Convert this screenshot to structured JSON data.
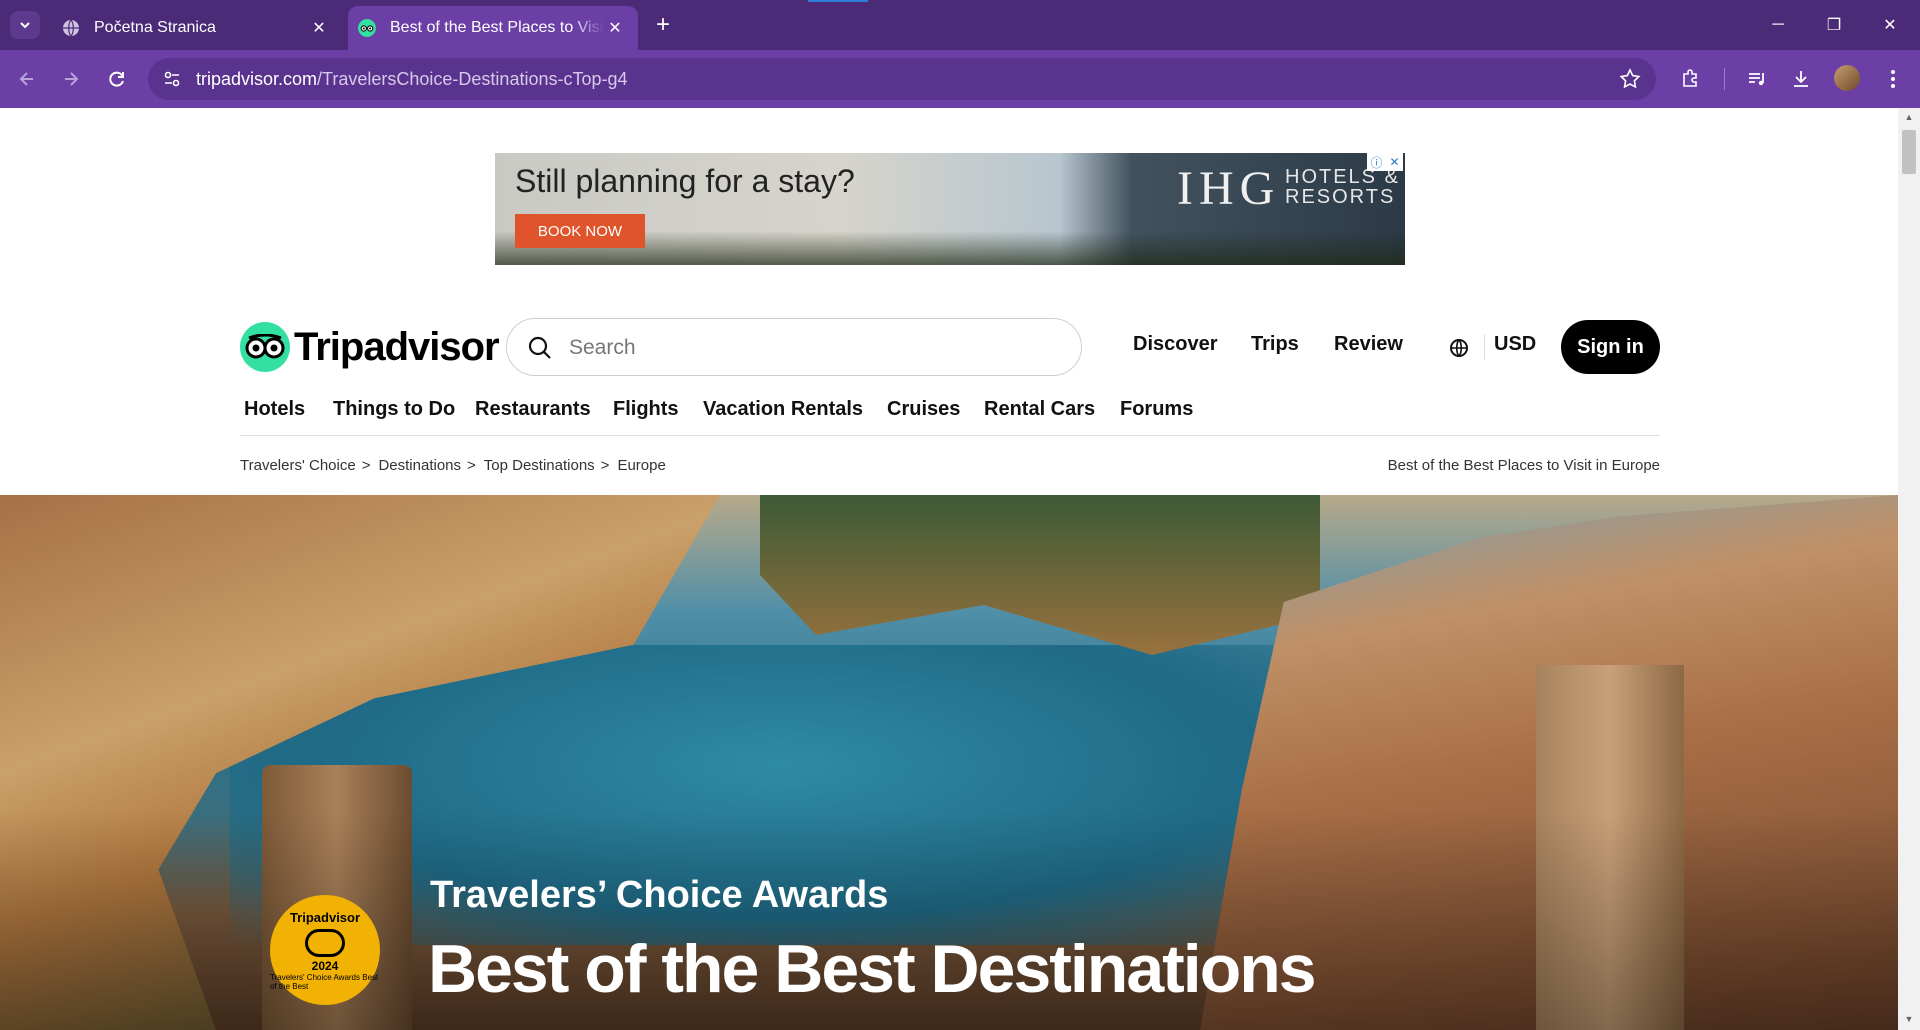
{
  "browser": {
    "tabs": [
      {
        "title": "Početna Stranica",
        "active": false,
        "favicon": "globe-icon"
      },
      {
        "title": "Best of the Best Places to Visit in Europe",
        "active": true,
        "favicon": "tripadvisor-owl-icon"
      }
    ],
    "url_host": "tripadvisor.com",
    "url_path": "/TravelersChoice-Destinations-cTop-g4",
    "colors": {
      "tab_strip": "#4b2a78",
      "toolbar": "#6b3fa6"
    }
  },
  "ad": {
    "headline": "Still planning for a stay?",
    "cta": "BOOK NOW",
    "brand": "IHG",
    "brand_sub_1": "HOTELS &",
    "brand_sub_2": "RESORTS"
  },
  "header": {
    "logo_text": "Tripadvisor",
    "search_placeholder": "Search",
    "nav": [
      "Discover",
      "Trips",
      "Review"
    ],
    "currency": "USD",
    "signin": "Sign in",
    "brand_color": "#34e0a1"
  },
  "categories": [
    "Hotels",
    "Things to Do",
    "Restaurants",
    "Flights",
    "Vacation Rentals",
    "Cruises",
    "Rental Cars",
    "Forums"
  ],
  "breadcrumb": {
    "items": [
      "Travelers' Choice",
      "Destinations",
      "Top Destinations",
      "Europe"
    ],
    "separator": ">",
    "right_text": "Best of the Best Places to Visit in Europe"
  },
  "hero": {
    "subtitle": "Travelers’ Choice Awards",
    "title": "Best of the Best Destinations",
    "badge": {
      "top": "Tripadvisor",
      "year": "2024",
      "ring": "Travelers' Choice Awards Best of the Best",
      "color": "#f2b203"
    }
  }
}
